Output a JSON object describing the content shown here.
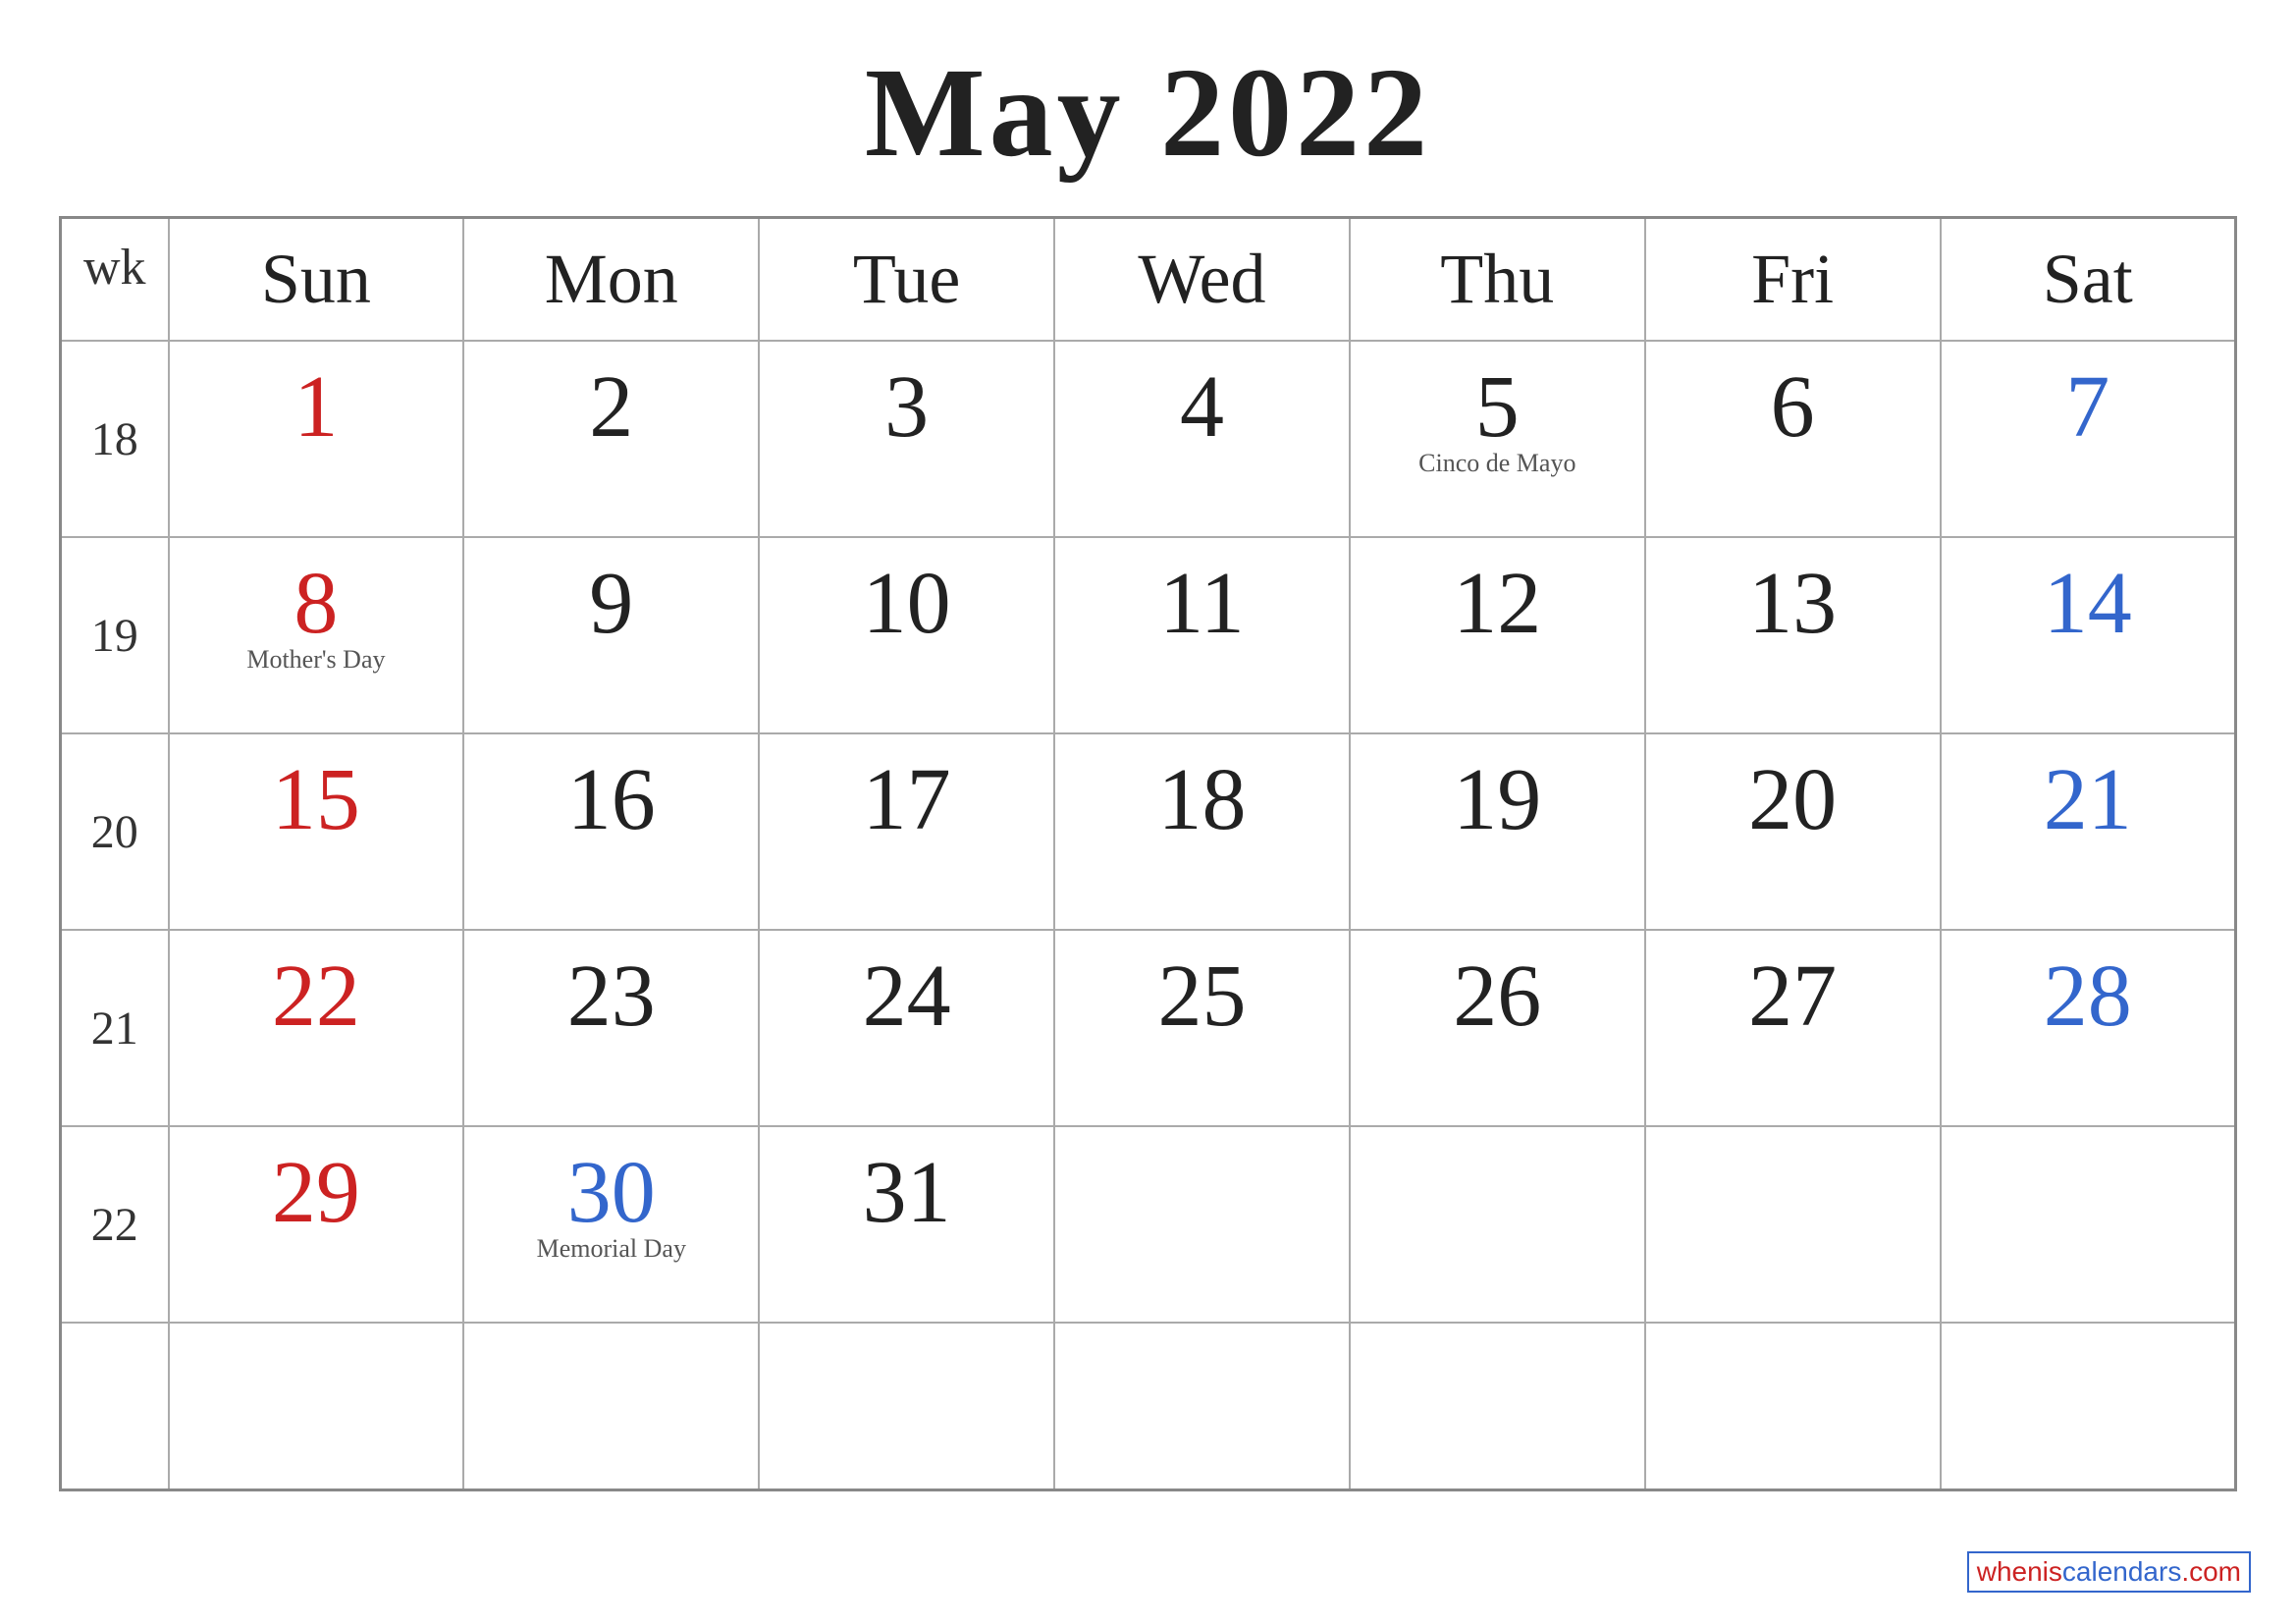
{
  "title": "May 2022",
  "header": {
    "wk_label": "wk",
    "days": [
      "Sun",
      "Mon",
      "Tue",
      "Wed",
      "Thu",
      "Fri",
      "Sat"
    ]
  },
  "weeks": [
    {
      "wk": "18",
      "days": [
        {
          "num": "1",
          "color": "red",
          "holiday": ""
        },
        {
          "num": "2",
          "color": "dark",
          "holiday": ""
        },
        {
          "num": "3",
          "color": "dark",
          "holiday": ""
        },
        {
          "num": "4",
          "color": "dark",
          "holiday": ""
        },
        {
          "num": "5",
          "color": "dark",
          "holiday": "Cinco de Mayo"
        },
        {
          "num": "6",
          "color": "dark",
          "holiday": ""
        },
        {
          "num": "7",
          "color": "blue",
          "holiday": ""
        }
      ]
    },
    {
      "wk": "19",
      "days": [
        {
          "num": "8",
          "color": "red",
          "holiday": "Mother's Day"
        },
        {
          "num": "9",
          "color": "dark",
          "holiday": ""
        },
        {
          "num": "10",
          "color": "dark",
          "holiday": ""
        },
        {
          "num": "11",
          "color": "dark",
          "holiday": ""
        },
        {
          "num": "12",
          "color": "dark",
          "holiday": ""
        },
        {
          "num": "13",
          "color": "dark",
          "holiday": ""
        },
        {
          "num": "14",
          "color": "blue",
          "holiday": ""
        }
      ]
    },
    {
      "wk": "20",
      "days": [
        {
          "num": "15",
          "color": "red",
          "holiday": ""
        },
        {
          "num": "16",
          "color": "dark",
          "holiday": ""
        },
        {
          "num": "17",
          "color": "dark",
          "holiday": ""
        },
        {
          "num": "18",
          "color": "dark",
          "holiday": ""
        },
        {
          "num": "19",
          "color": "dark",
          "holiday": ""
        },
        {
          "num": "20",
          "color": "dark",
          "holiday": ""
        },
        {
          "num": "21",
          "color": "blue",
          "holiday": ""
        }
      ]
    },
    {
      "wk": "21",
      "days": [
        {
          "num": "22",
          "color": "red",
          "holiday": ""
        },
        {
          "num": "23",
          "color": "dark",
          "holiday": ""
        },
        {
          "num": "24",
          "color": "dark",
          "holiday": ""
        },
        {
          "num": "25",
          "color": "dark",
          "holiday": ""
        },
        {
          "num": "26",
          "color": "dark",
          "holiday": ""
        },
        {
          "num": "27",
          "color": "dark",
          "holiday": ""
        },
        {
          "num": "28",
          "color": "blue",
          "holiday": ""
        }
      ]
    },
    {
      "wk": "22",
      "days": [
        {
          "num": "29",
          "color": "red",
          "holiday": ""
        },
        {
          "num": "30",
          "color": "blue",
          "holiday": "Memorial Day"
        },
        {
          "num": "31",
          "color": "dark",
          "holiday": ""
        },
        {
          "num": "",
          "color": "dark",
          "holiday": ""
        },
        {
          "num": "",
          "color": "dark",
          "holiday": ""
        },
        {
          "num": "",
          "color": "dark",
          "holiday": ""
        },
        {
          "num": "",
          "color": "dark",
          "holiday": ""
        }
      ]
    },
    {
      "wk": "",
      "days": [
        {
          "num": "",
          "color": "dark",
          "holiday": ""
        },
        {
          "num": "",
          "color": "dark",
          "holiday": ""
        },
        {
          "num": "",
          "color": "dark",
          "holiday": ""
        },
        {
          "num": "",
          "color": "dark",
          "holiday": ""
        },
        {
          "num": "",
          "color": "dark",
          "holiday": ""
        },
        {
          "num": "",
          "color": "dark",
          "holiday": ""
        },
        {
          "num": "",
          "color": "dark",
          "holiday": ""
        }
      ]
    }
  ],
  "watermark": {
    "text_red": "whenis",
    "text_blue": "calendars",
    "text_end": ".com"
  }
}
